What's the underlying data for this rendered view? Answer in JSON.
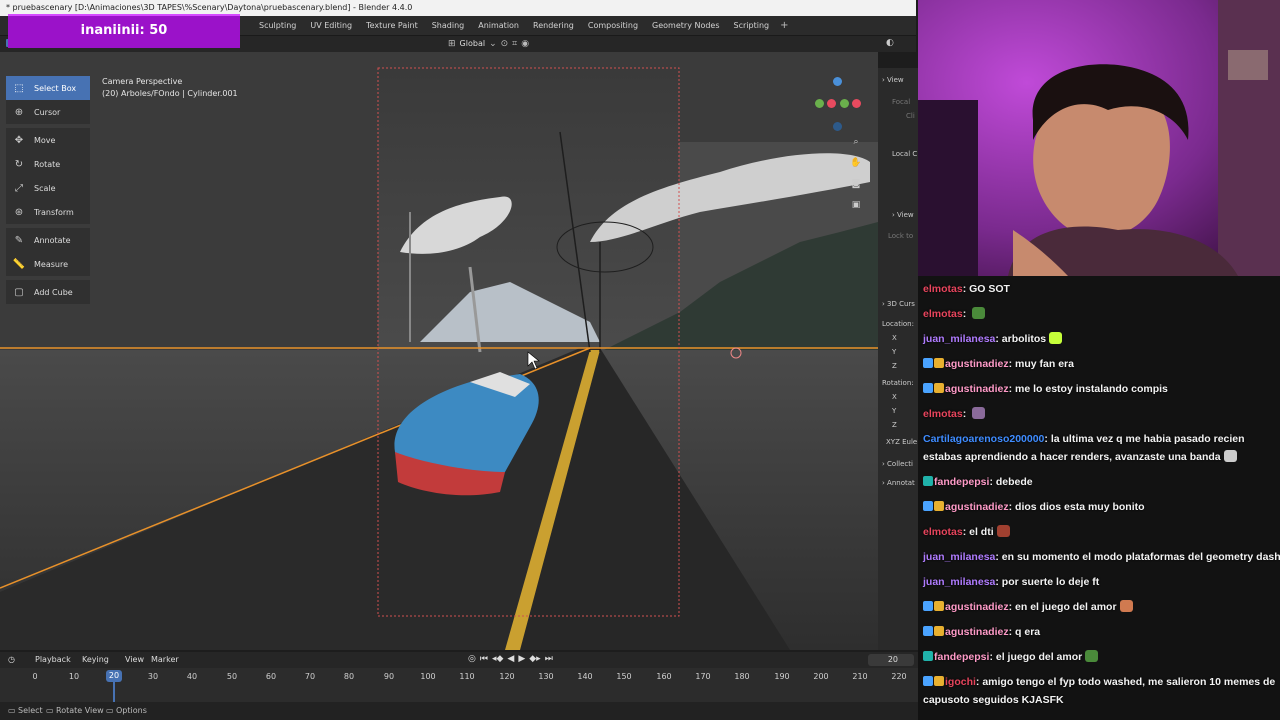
{
  "window": {
    "title": "* pruebascenary [D:\\Animaciones\\3D TAPES\\%Scenary\\Daytona\\pruebascenary.blend] - Blender 4.4.0"
  },
  "workspace_tabs": [
    "Sculpting",
    "UV Editing",
    "Texture Paint",
    "Shading",
    "Animation",
    "Rendering",
    "Compositing",
    "Geometry Nodes",
    "Scripting"
  ],
  "workspace_add": "+",
  "viewport_header": {
    "orientation": "Global"
  },
  "donation_overlay": {
    "text": "inaniinii: 50"
  },
  "viewport": {
    "camera_label": "Camera Perspective",
    "object_label": "(20) Arboles/FOndo | Cylinder.001"
  },
  "toolbar": {
    "tools": [
      {
        "label": "Select Box",
        "icon": "select-box-icon",
        "active": true
      },
      {
        "label": "Cursor",
        "icon": "cursor-icon"
      },
      {
        "label": "Move",
        "icon": "move-icon"
      },
      {
        "label": "Rotate",
        "icon": "rotate-icon"
      },
      {
        "label": "Scale",
        "icon": "scale-icon"
      },
      {
        "label": "Transform",
        "icon": "transform-icon"
      },
      {
        "label": "Annotate",
        "icon": "annotate-icon"
      },
      {
        "label": "Measure",
        "icon": "measure-icon"
      },
      {
        "label": "Add Cube",
        "icon": "add-cube-icon"
      }
    ]
  },
  "gizmo": {
    "x_color": "#e84a5f",
    "y_color": "#6ab04c",
    "z_color": "#4a90d9"
  },
  "npanel": {
    "view_header": "View",
    "focal": "Focal",
    "clip": "Cli",
    "local_camera": "Local C",
    "view_lock_header": "View",
    "lock_to": "Lock to",
    "cursor_header": "3D Curs",
    "location": "Location:",
    "x": "X",
    "y": "Y",
    "z": "Z",
    "rotation": "Rotation:",
    "rot_mode": "XYZ Eule",
    "collections": "Collecti",
    "annotations": "Annotat"
  },
  "timeline": {
    "menus": [
      "Playback",
      "Keying",
      "View",
      "Marker"
    ],
    "current_frame": "20",
    "frame_field": "20",
    "ticks": [
      "0",
      "10",
      "30",
      "40",
      "50",
      "60",
      "70",
      "80",
      "90",
      "100",
      "110",
      "120",
      "130",
      "140",
      "150",
      "160",
      "170",
      "180",
      "190",
      "200",
      "210",
      "220"
    ]
  },
  "statusbar": {
    "select": "Select",
    "rotate_view": "Rotate View",
    "options": "Options"
  },
  "chat": {
    "messages": [
      {
        "user": "elmotas",
        "color": "#e8455d",
        "text": "GO SOT"
      },
      {
        "user": "elmotas",
        "color": "#e8455d",
        "text": "",
        "emote": "#4a8a3a"
      },
      {
        "user": "juan_milanesa",
        "color": "#b07cff",
        "text": "arbolitos",
        "emote": "#c6ff3a"
      },
      {
        "user": "agustinadiez",
        "color": "#ff9bc8",
        "text": "muy fan era",
        "badges": true
      },
      {
        "user": "agustinadiez",
        "color": "#ff9bc8",
        "text": "me lo estoy instalando compis",
        "badges": true
      },
      {
        "user": "elmotas",
        "color": "#e8455d",
        "text": "",
        "emote": "#8a6a9a"
      },
      {
        "user": "Cartilagoarenoso200000",
        "color": "#3f8cff",
        "text": "la ultima vez q me habia pasado recien estabas aprendiendo a hacer renders, avanzaste una banda",
        "emote": "#cccccc",
        "wrap": true
      },
      {
        "user": "fandepepsi",
        "color": "#ff9bc8",
        "text": "debede",
        "badge_color": "#20b2aa"
      },
      {
        "user": "agustinadiez",
        "color": "#ff9bc8",
        "text": "dios dios esta muy bonito",
        "badges": true
      },
      {
        "user": "elmotas",
        "color": "#e8455d",
        "text": "el dti",
        "emote": "#a04030"
      },
      {
        "user": "juan_milanesa",
        "color": "#b07cff",
        "text": "en su momento el modo plataformas del geometry dash",
        "emote": "#c8b090"
      },
      {
        "user": "juan_milanesa",
        "color": "#b07cff",
        "text": "por suerte lo deje ft"
      },
      {
        "user": "agustinadiez",
        "color": "#ff9bc8",
        "text": "en el juego del amor",
        "badges": true,
        "emote": "#d07a50"
      },
      {
        "user": "agustinadiez",
        "color": "#ff9bc8",
        "text": "q era",
        "badges": true
      },
      {
        "user": "fandepepsi",
        "color": "#ff9bc8",
        "text": "el juego del amor",
        "badge_color": "#20b2aa",
        "emote": "#4a8a3a"
      },
      {
        "user": "igochi",
        "color": "#e8455d",
        "text": "amigo tengo el fyp todo washed, me salieron 10 memes de capusoto seguidos KJASFK",
        "wrap": true,
        "badges": true
      }
    ]
  }
}
